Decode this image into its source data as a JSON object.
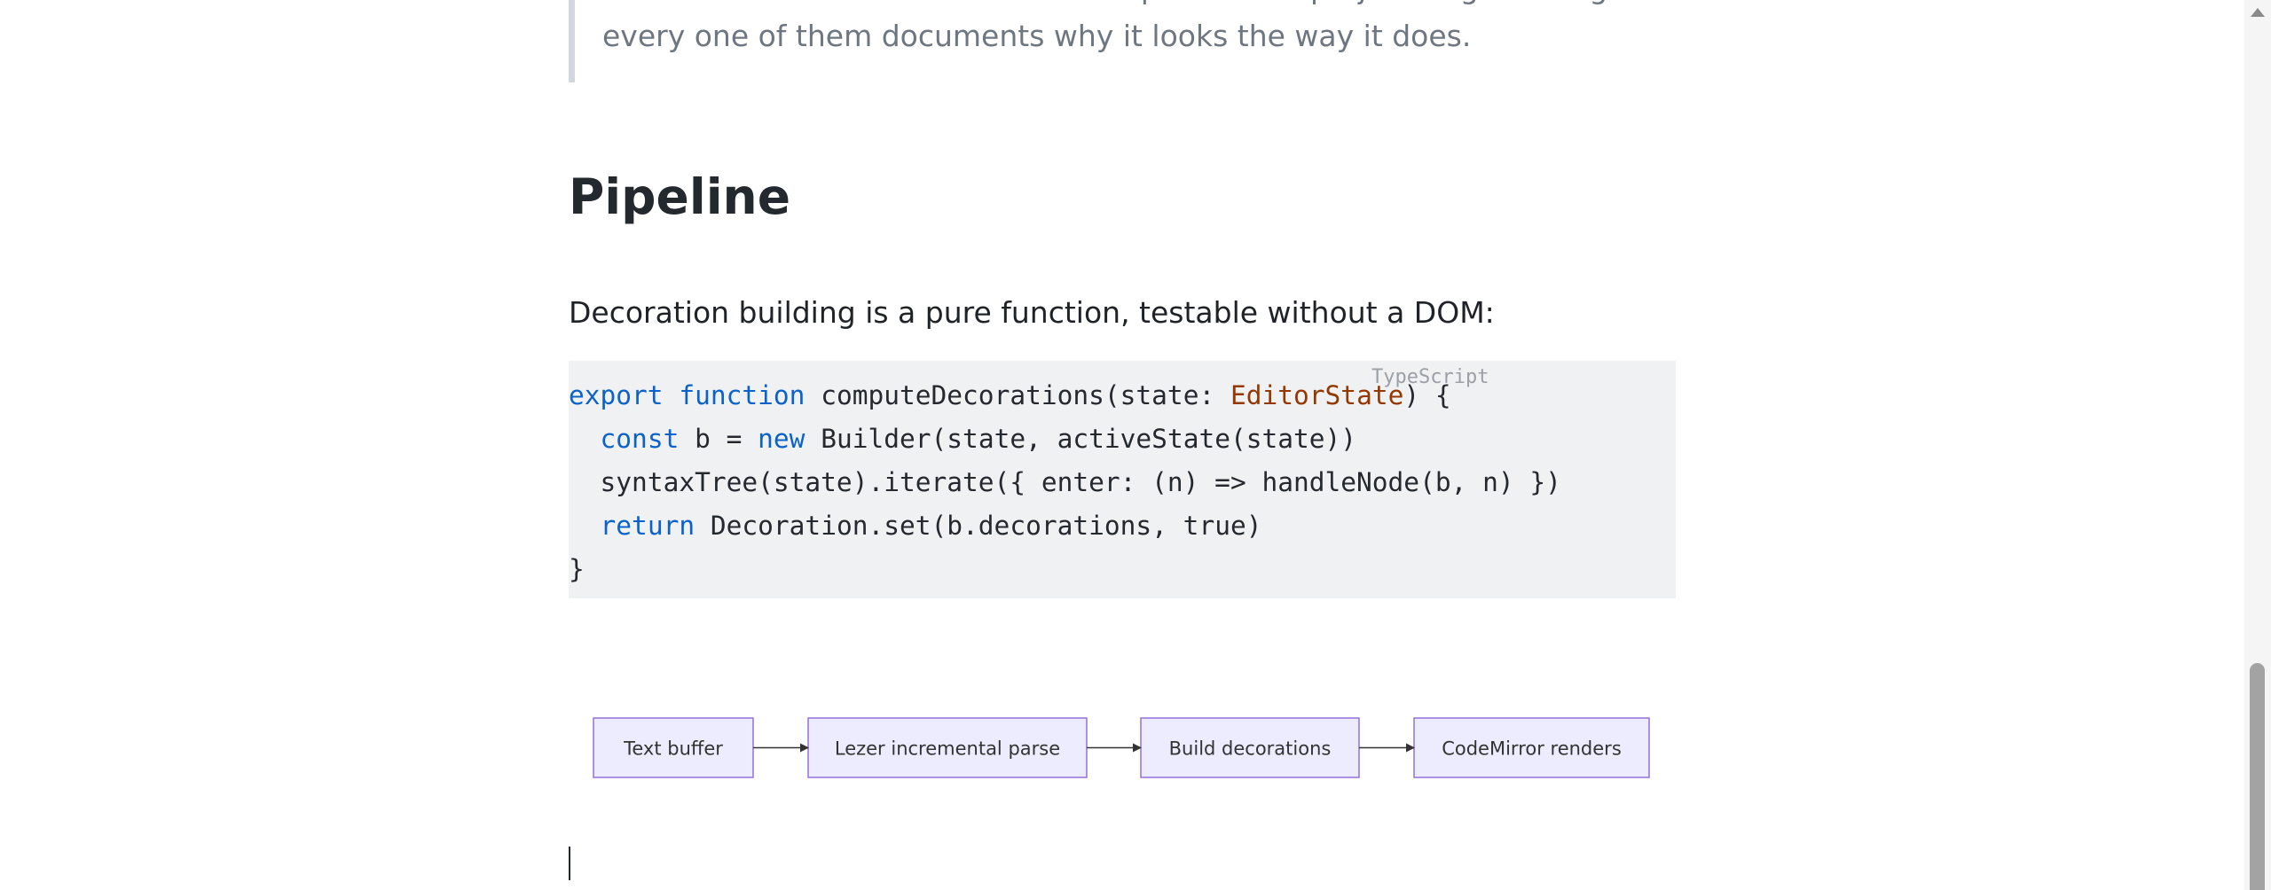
{
  "blockquote": {
    "line1": "The decoration rules are the easiest part of this project to get wrong —",
    "line2": "every one of them documents why it looks the way it does."
  },
  "section": {
    "heading": "Pipeline",
    "paragraph": "Decoration building is a pure function, testable without a DOM:"
  },
  "code_block": {
    "language": "TypeScript",
    "line1": {
      "kw1": "export",
      "kw2": "function",
      "name": "computeDecorations(state: ",
      "type": "EditorState",
      "rest": ") {"
    },
    "line2": {
      "indent": "  ",
      "kw": "const",
      "mid": " b = ",
      "kw2": "new",
      "rest": " Builder(state, activeState(state))"
    },
    "line3": {
      "text": "  syntaxTree(state).iterate({ enter: (n) => handleNode(b, n) })"
    },
    "line4": {
      "indent": "  ",
      "kw": "return",
      "rest": " Decoration.set(b.decorations, true)"
    },
    "line5": {
      "text": "}"
    }
  },
  "diagram": {
    "nodes": [
      "Text buffer",
      "Lezer incremental parse",
      "Build decorations",
      "CodeMirror renders"
    ],
    "colors": {
      "fill": "#ececfe",
      "stroke": "#9370db",
      "text": "#333333",
      "arrow": "#333333"
    }
  },
  "colors": {
    "keyword": "#0b63c9",
    "type": "#953800",
    "code_bg": "#f0f1f3",
    "quote_border": "#d0d7de",
    "quote_text": "#6e7781"
  },
  "icons": [
    "scroll-up-arrow-icon"
  ]
}
